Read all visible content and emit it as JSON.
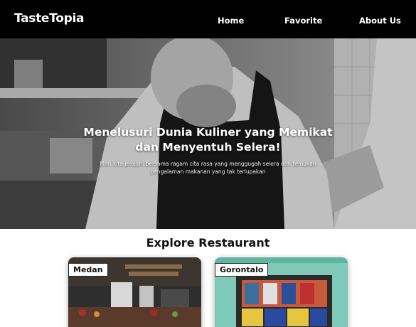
{
  "header": {
    "brand": "TasteTopia",
    "nav": [
      {
        "label": "Home"
      },
      {
        "label": "Favorite"
      },
      {
        "label": "About Us"
      }
    ]
  },
  "hero": {
    "title_line1": "Menelusuri Dunia Kuliner yang Memikat",
    "title_line2": "dan Menyentuh Selera!",
    "subtitle_line1": "Mari kita jelajahi bersama ragam cita rasa yang menggugah selera dan temukan",
    "subtitle_line2": "pengalaman makanan yang tak terlupakan"
  },
  "explore": {
    "title": "Explore Restaurant",
    "cards": [
      {
        "city": "Medan"
      },
      {
        "city": "Gorontalo"
      }
    ]
  }
}
